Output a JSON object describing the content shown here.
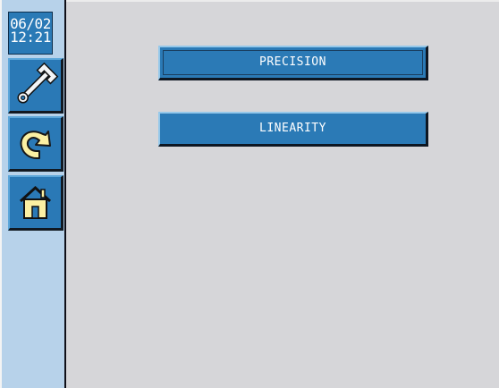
{
  "sidebar": {
    "clock": {
      "date": "06/02",
      "time": "12:21"
    },
    "buttons": [
      {
        "name": "tools",
        "icon": "wrench-icon"
      },
      {
        "name": "return",
        "icon": "return-arrow-icon"
      },
      {
        "name": "home",
        "icon": "home-icon"
      }
    ]
  },
  "main": {
    "buttons": {
      "precision": "PRECISION",
      "linearity": "LINEARITY"
    }
  },
  "colors": {
    "background": "#d6d6d9",
    "sidebar": "#b7d2ea",
    "button": "#2a7ab6",
    "text": "#ffffff"
  }
}
